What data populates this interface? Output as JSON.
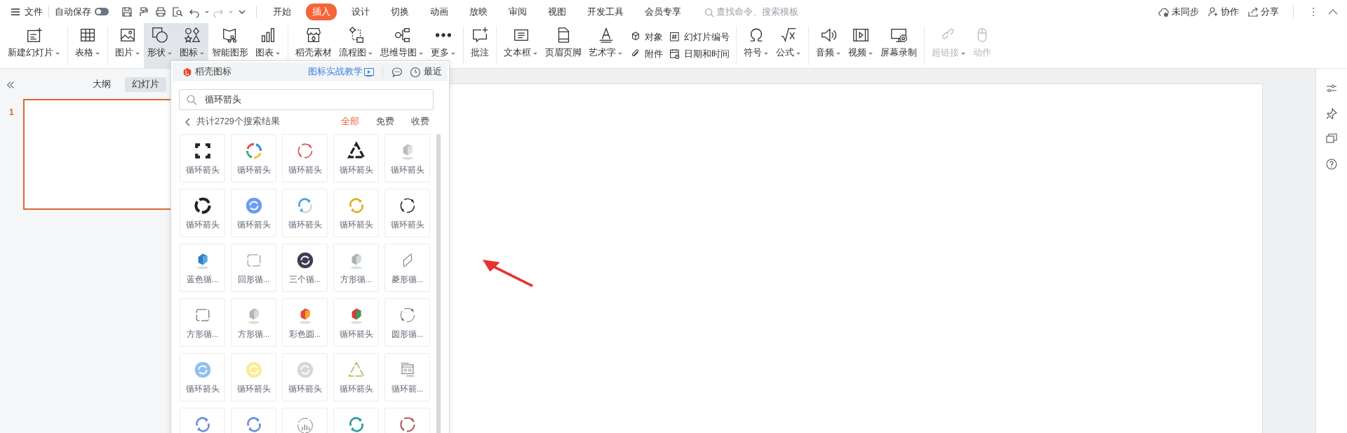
{
  "menu": {
    "file": "文件",
    "autosave": {
      "label": "自动保存",
      "on": false
    },
    "tabs": [
      {
        "label": "开始",
        "selected": false
      },
      {
        "label": "插入",
        "selected": true
      },
      {
        "label": "设计",
        "selected": false
      },
      {
        "label": "切换",
        "selected": false
      },
      {
        "label": "动画",
        "selected": false
      },
      {
        "label": "放映",
        "selected": false
      },
      {
        "label": "审阅",
        "selected": false
      },
      {
        "label": "视图",
        "selected": false
      },
      {
        "label": "开发工具",
        "selected": false
      },
      {
        "label": "会员专享",
        "selected": false
      }
    ],
    "search": {
      "placeholder": "查找命令、搜索模板"
    },
    "sync": "未同步",
    "collaborate": "协作",
    "share": "分享"
  },
  "ribbon": [
    [
      {
        "kind": "large",
        "label": "新建幻灯片",
        "dropdown": true,
        "pressed": false,
        "disabled": false
      }
    ],
    [
      {
        "kind": "large",
        "label": "表格",
        "dropdown": true,
        "pressed": false,
        "disabled": false
      }
    ],
    [
      {
        "kind": "large",
        "label": "图片",
        "dropdown": true,
        "pressed": false,
        "disabled": false
      },
      {
        "kind": "large",
        "label": "形状",
        "dropdown": true,
        "pressed": true,
        "disabled": false
      },
      {
        "kind": "large",
        "label": "图标",
        "dropdown": true,
        "pressed": true,
        "disabled": false
      },
      {
        "kind": "large",
        "label": "智能图形",
        "dropdown": false,
        "pressed": false,
        "disabled": false
      },
      {
        "kind": "large",
        "label": "图表",
        "dropdown": true,
        "pressed": false,
        "disabled": false
      }
    ],
    [
      {
        "kind": "large",
        "label": "稻壳素材",
        "dropdown": false,
        "pressed": false,
        "disabled": false
      },
      {
        "kind": "large",
        "label": "流程图",
        "dropdown": true,
        "pressed": false,
        "disabled": false
      },
      {
        "kind": "large",
        "label": "思维导图",
        "dropdown": true,
        "pressed": false,
        "disabled": false
      },
      {
        "kind": "large",
        "label": "更多",
        "dropdown": true,
        "pressed": false,
        "disabled": false
      }
    ],
    [
      {
        "kind": "large",
        "label": "批注",
        "dropdown": false,
        "pressed": false,
        "disabled": false
      }
    ],
    [
      {
        "kind": "large",
        "label": "文本框",
        "dropdown": true,
        "pressed": false,
        "disabled": false
      },
      {
        "kind": "large",
        "label": "页眉页脚",
        "dropdown": false,
        "pressed": false,
        "disabled": false
      },
      {
        "kind": "large",
        "label": "艺术字",
        "dropdown": true,
        "pressed": false,
        "disabled": false
      },
      {
        "kind": "pair",
        "items": [
          {
            "label": "对象",
            "disabled": false
          },
          {
            "label": "附件",
            "disabled": false
          }
        ]
      },
      {
        "kind": "pair",
        "items": [
          {
            "label": "幻灯片编号",
            "disabled": false
          },
          {
            "label": "日期和时间",
            "disabled": false
          }
        ]
      }
    ],
    [
      {
        "kind": "large",
        "label": "符号",
        "dropdown": true,
        "pressed": false,
        "disabled": false
      },
      {
        "kind": "large",
        "label": "公式",
        "dropdown": true,
        "pressed": false,
        "disabled": false
      }
    ],
    [
      {
        "kind": "large",
        "label": "音频",
        "dropdown": true,
        "pressed": false,
        "disabled": false
      },
      {
        "kind": "large",
        "label": "视频",
        "dropdown": true,
        "pressed": false,
        "disabled": false
      },
      {
        "kind": "large",
        "label": "屏幕录制",
        "dropdown": false,
        "pressed": false,
        "disabled": false
      }
    ],
    [
      {
        "kind": "large",
        "label": "超链接",
        "dropdown": true,
        "pressed": false,
        "disabled": true
      },
      {
        "kind": "large",
        "label": "动作",
        "dropdown": false,
        "pressed": false,
        "disabled": true
      }
    ]
  ],
  "left_pane": {
    "tabs": [
      {
        "label": "大纲",
        "selected": false
      },
      {
        "label": "幻灯片",
        "selected": true
      }
    ],
    "slides": [
      {
        "number": "1",
        "selected": true
      }
    ]
  },
  "icon_panel": {
    "title": "稻壳图标",
    "tutorial_link": "图标实战教学",
    "recent": "最近",
    "search": {
      "value": "循环箭头"
    },
    "result_count": "共计2729个搜索结果",
    "filters": [
      {
        "label": "全部",
        "selected": true
      },
      {
        "label": "免费",
        "selected": false
      },
      {
        "label": "收费",
        "selected": false
      }
    ],
    "results": [
      {
        "kind": "labeled",
        "label": "循环箭头"
      },
      {
        "kind": "labeled",
        "label": "循环箭头"
      },
      {
        "kind": "labeled",
        "label": "循环箭头"
      },
      {
        "kind": "labeled",
        "label": "循环箭头"
      },
      {
        "kind": "labeled",
        "label": "循环箭头"
      },
      {
        "kind": "labeled",
        "label": "循环箭头"
      },
      {
        "kind": "labeled",
        "label": "循环箭头"
      },
      {
        "kind": "labeled",
        "label": "循环箭头"
      },
      {
        "kind": "labeled",
        "label": "循环箭头"
      },
      {
        "kind": "labeled",
        "label": "循环箭头"
      },
      {
        "kind": "labeled",
        "label": "蓝色循..."
      },
      {
        "kind": "labeled",
        "label": "回形循..."
      },
      {
        "kind": "labeled",
        "label": "三个循..."
      },
      {
        "kind": "labeled",
        "label": "方形循..."
      },
      {
        "kind": "labeled",
        "label": "菱形循..."
      },
      {
        "kind": "labeled",
        "label": "方形循..."
      },
      {
        "kind": "labeled",
        "label": "方形循..."
      },
      {
        "kind": "labeled",
        "label": "彩色圆..."
      },
      {
        "kind": "labeled",
        "label": "循环箭头"
      },
      {
        "kind": "labeled",
        "label": "圆形循..."
      },
      {
        "kind": "labeled",
        "label": "循环箭头"
      },
      {
        "kind": "labeled",
        "label": "循环箭头"
      },
      {
        "kind": "labeled",
        "label": "循环箭头"
      },
      {
        "kind": "labeled",
        "label": "循环箭头"
      },
      {
        "kind": "labeled",
        "label": "循环箭..."
      },
      {
        "kind": "icon"
      },
      {
        "kind": "icon"
      },
      {
        "kind": "icon"
      },
      {
        "kind": "icon"
      },
      {
        "kind": "icon"
      }
    ]
  }
}
